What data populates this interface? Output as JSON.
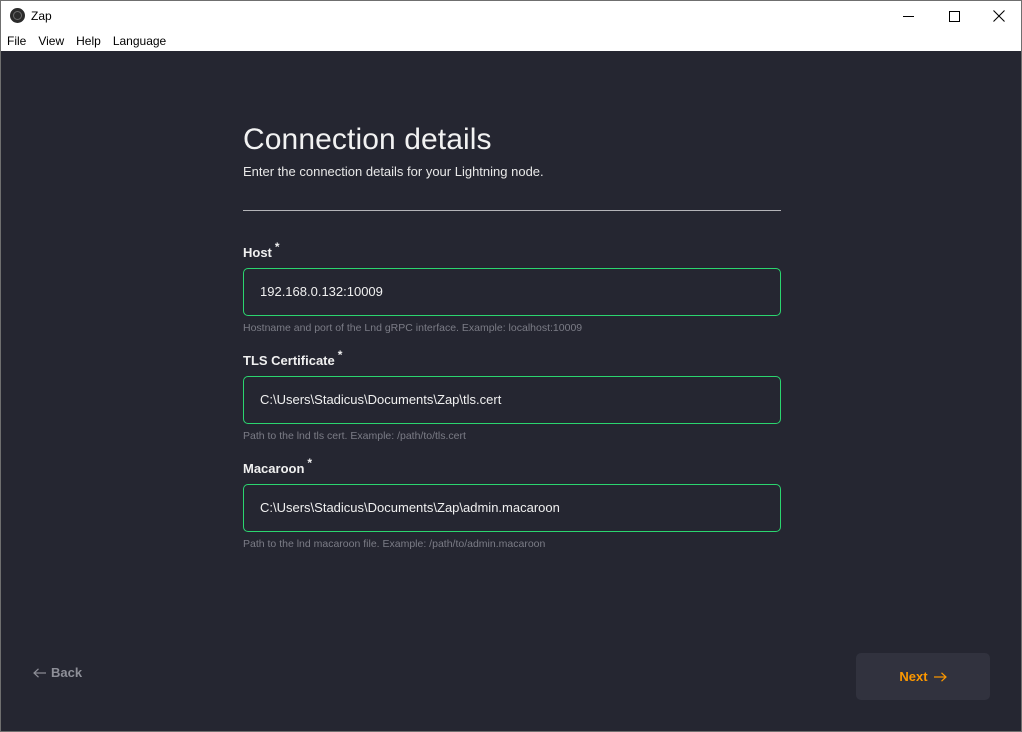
{
  "window": {
    "title": "Zap",
    "controls": [
      "minimize-icon",
      "maximize-icon",
      "close-icon"
    ]
  },
  "menubar": {
    "items": [
      "File",
      "View",
      "Help",
      "Language"
    ]
  },
  "page": {
    "title": "Connection details",
    "subtitle": "Enter the connection details for your Lightning node."
  },
  "fields": {
    "host": {
      "label": "Host",
      "required_mark": "*",
      "value": "192.168.0.132:10009",
      "hint": "Hostname and port of the Lnd gRPC interface. Example: localhost:10009"
    },
    "tls": {
      "label": "TLS Certificate",
      "required_mark": "*",
      "value": "C:\\Users\\Stadicus\\Documents\\Zap\\tls.cert",
      "hint": "Path to the lnd tls cert. Example: /path/to/tls.cert"
    },
    "macaroon": {
      "label": "Macaroon",
      "required_mark": "*",
      "value": "C:\\Users\\Stadicus\\Documents\\Zap\\admin.macaroon",
      "hint": "Path to the lnd macaroon file. Example: /path/to/admin.macaroon"
    }
  },
  "nav": {
    "back_label": "Back",
    "next_label": "Next"
  },
  "colors": {
    "background": "#252631",
    "input_border": "#2bd56f",
    "accent": "#fd9800",
    "hint": "#7b7c86"
  }
}
